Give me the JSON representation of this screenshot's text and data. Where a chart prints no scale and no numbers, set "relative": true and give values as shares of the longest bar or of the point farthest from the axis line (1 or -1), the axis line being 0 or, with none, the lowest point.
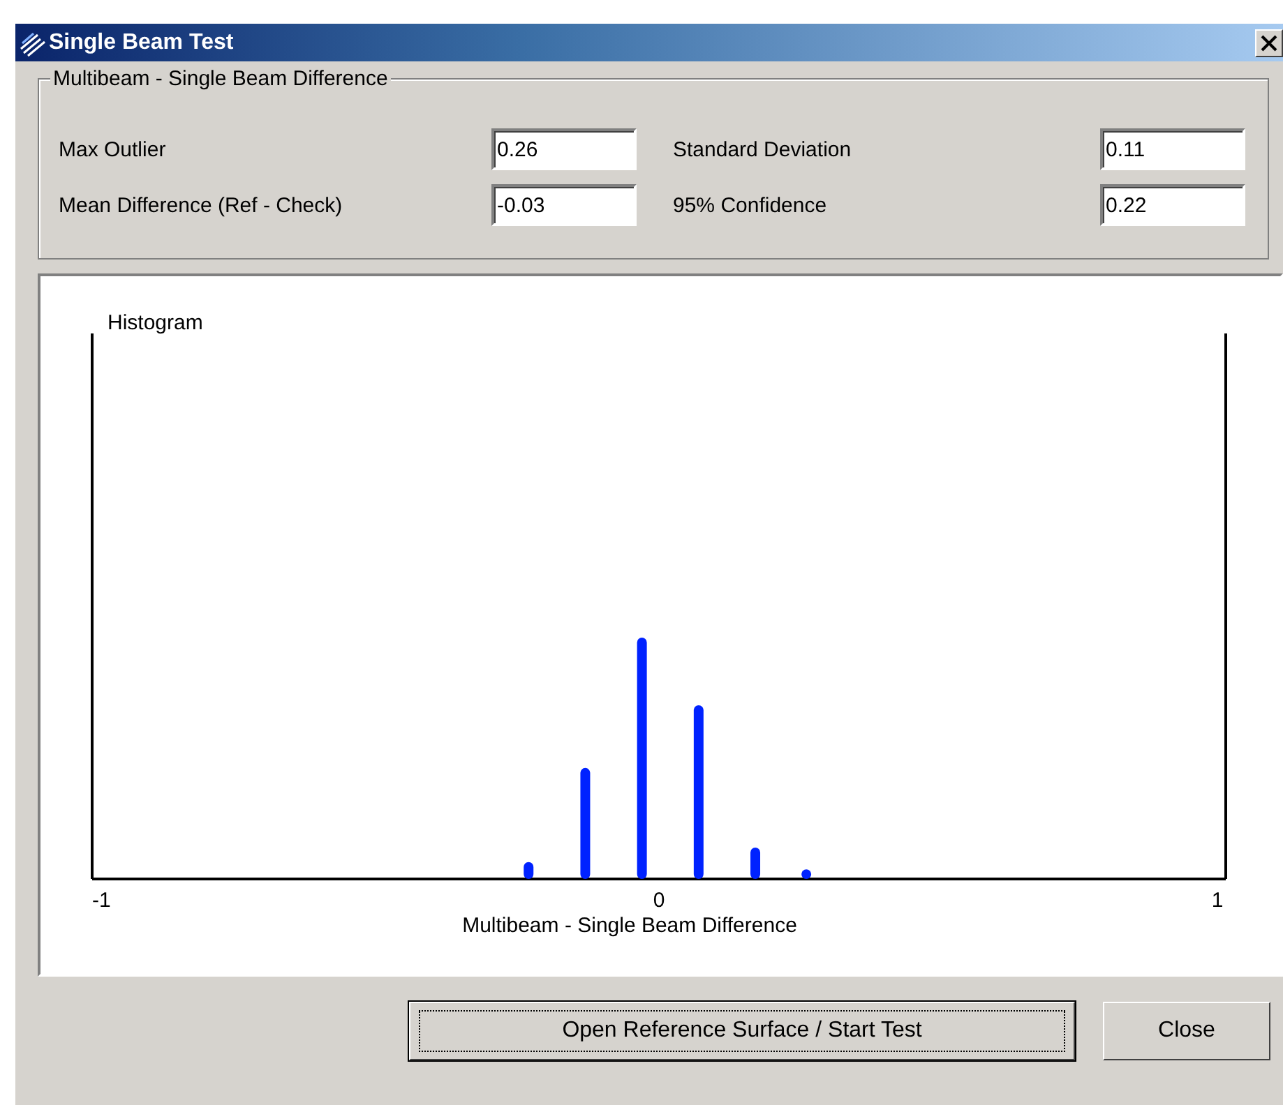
{
  "window": {
    "title": "Single Beam Test"
  },
  "group": {
    "title": "Multibeam - Single Beam Difference",
    "fields": [
      {
        "label": "Max Outlier",
        "value": "0.26"
      },
      {
        "label": "Standard Deviation",
        "value": "0.11"
      },
      {
        "label": "Mean Difference (Ref - Check)",
        "value": "-0.03"
      },
      {
        "label": "95% Confidence",
        "value": "0.22"
      }
    ]
  },
  "chart": {
    "chart_data": {
      "type": "bar",
      "title": "Histogram",
      "xlabel": "Multibeam - Single Beam Difference",
      "x": [
        -0.23,
        -0.13,
        -0.03,
        0.07,
        0.17,
        0.26
      ],
      "xlim": [
        -1,
        1
      ],
      "xticks": [
        -1,
        0,
        1
      ],
      "relative": true,
      "series": [
        {
          "color": "#0022ff",
          "values": [
            0.07,
            0.46,
            1,
            0.72,
            0.13,
            0.04
          ]
        }
      ]
    }
  },
  "buttons": [
    {
      "label": "Open Reference Surface / Start Test",
      "default": true
    },
    {
      "label": "Close",
      "default": false
    }
  ]
}
